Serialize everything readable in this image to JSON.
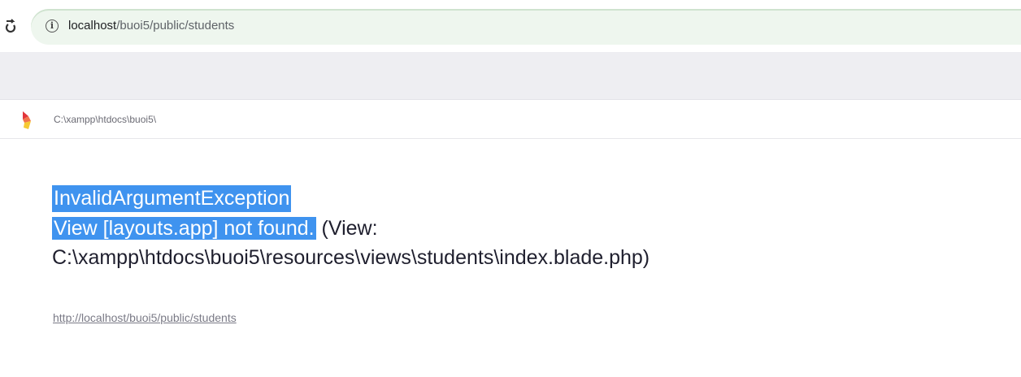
{
  "browser": {
    "url_host": "localhost",
    "url_path": "/buoi5/public/students",
    "info_icon": "info-icon",
    "reload_icon": "reload-icon"
  },
  "header": {
    "app_path": "C:\\xampp\\htdocs\\buoi5\\",
    "logo_icon": "ignition-logo-icon"
  },
  "exception": {
    "class": "InvalidArgumentException",
    "message_highlight": "View [layouts.app] not found.",
    "message_rest": " (View: C:\\xampp\\htdocs\\buoi5\\resources\\views\\students\\index.blade.php)"
  },
  "request": {
    "url": "http://localhost/buoi5/public/students"
  },
  "colors": {
    "selection": "#3f93ef",
    "omnibox": "#eef6ee",
    "strip": "#eeeef2"
  }
}
